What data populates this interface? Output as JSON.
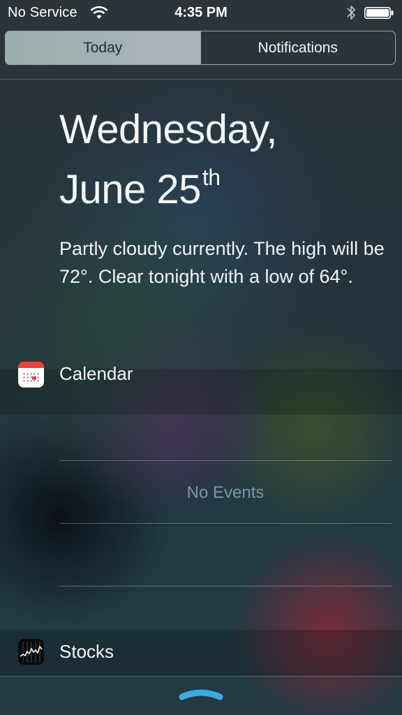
{
  "status_bar": {
    "carrier": "No Service",
    "time": "4:35 PM",
    "wifi_icon": "wifi-icon",
    "bluetooth_icon": "bluetooth-icon",
    "battery_icon": "battery-icon"
  },
  "segmented_control": {
    "tabs": [
      {
        "label": "Today",
        "selected": true
      },
      {
        "label": "Notifications",
        "selected": false
      }
    ]
  },
  "today": {
    "date_line1": "Wednesday,",
    "date_line2": "June 25",
    "date_suffix": "th",
    "weather_summary": "Partly cloudy currently. The high will be 72°. Clear tonight with a low of 64°."
  },
  "calendar": {
    "title": "Calendar",
    "icon": "calendar-icon",
    "empty_text": "No Events"
  },
  "stocks": {
    "title": "Stocks",
    "icon": "stocks-icon"
  },
  "handle_icon": "grabber-handle-icon",
  "colors": {
    "selected_tab_bg": "#c9d5d6",
    "calendar_red": "#e8423c",
    "no_events_text": "#7c97a4",
    "handle_blue": "#3fa9e0"
  }
}
